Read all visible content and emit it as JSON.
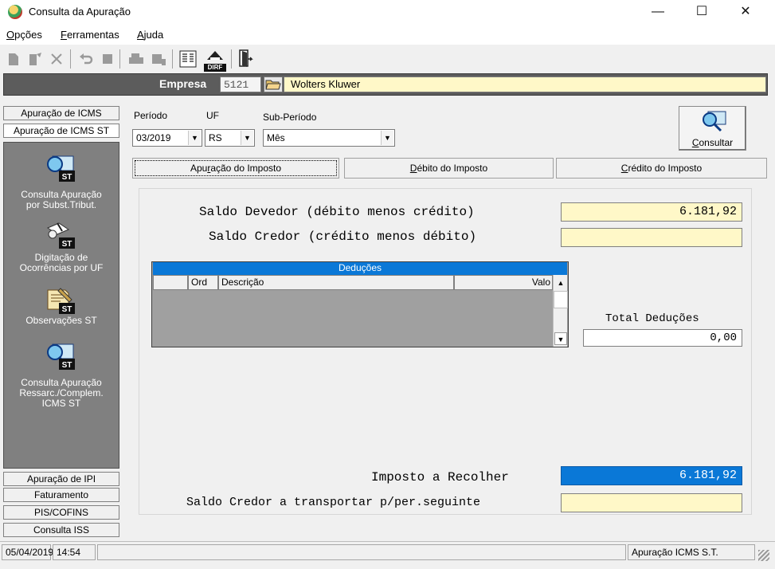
{
  "window": {
    "title": "Consulta da Apuração",
    "minimize": "—",
    "maximize": "☐",
    "close": "✕"
  },
  "menu": [
    {
      "label": "Opções",
      "accel": "O",
      "rest": "pções"
    },
    {
      "label": "Ferramentas",
      "accel": "F",
      "rest": "erramentas"
    },
    {
      "label": "Ajuda",
      "accel": "A",
      "rest": "juda"
    }
  ],
  "toolbar": {
    "icons": [
      "new-doc-icon",
      "edit-doc-icon",
      "delete-icon",
      "undo-icon",
      "stop-icon",
      "print-icon",
      "preview-icon",
      "report-icon",
      "dirf-icon",
      "exit-door-icon"
    ],
    "dirf_label": "DIRF"
  },
  "empresa": {
    "label": "Empresa",
    "code": "5121",
    "name": "Wolters Kluwer"
  },
  "sidebar": {
    "top_tabs": [
      "Apuração de ICMS",
      "Apuração de ICMS ST"
    ],
    "items": [
      {
        "caption": "Consulta Apuração por Subst.Tribut.",
        "lines": [
          "Consulta Apuração",
          "por Subst.Tribut."
        ],
        "icon": "consult-st-icon"
      },
      {
        "caption": "Digitação de Ocorrências por UF",
        "lines": [
          "Digitação de",
          "Ocorrências por UF"
        ],
        "icon": "typing-st-icon"
      },
      {
        "caption": "Observações ST",
        "lines": [
          "Observações ST"
        ],
        "icon": "notes-st-icon"
      },
      {
        "caption": "Consulta Apuração Ressarc./Complem. ICMS ST",
        "lines": [
          "Consulta Apuração",
          "Ressarc./Complem.",
          "ICMS ST"
        ],
        "icon": "consult-ressarc-st-icon"
      }
    ],
    "st_badge": "ST",
    "bottom_tabs": [
      "Apuração de IPI",
      "Faturamento",
      "PIS/COFINS",
      "Consulta ISS"
    ]
  },
  "filters": {
    "periodo_label": "Período",
    "periodo_value": "03/2019",
    "uf_label": "UF",
    "uf_value": "RS",
    "subperiodo_label": "Sub-Período",
    "subperiodo_value": "Mês",
    "consultar_label": "Consultar",
    "consultar_accel": "C",
    "consultar_rest": "onsultar"
  },
  "tabs": [
    {
      "label": "Apuração do Imposto",
      "pre": "Apu",
      "accel": "r",
      "post": "ação do Imposto",
      "active": true
    },
    {
      "label": "Débito do Imposto",
      "pre": "",
      "accel": "D",
      "post": "ébito do Imposto",
      "active": false
    },
    {
      "label": "Crédito do Imposto",
      "pre": "",
      "accel": "C",
      "post": "rédito do Imposto",
      "active": false
    }
  ],
  "apuracao": {
    "saldo_devedor_label": "Saldo Devedor (débito menos crédito)",
    "saldo_devedor_value": "6.181,92",
    "saldo_credor_label": "Saldo Credor (crédito menos débito)",
    "saldo_credor_value": "",
    "deducoes": {
      "title": "Deduções",
      "columns": [
        "",
        "Ord",
        "Descrição",
        "Valo"
      ],
      "rows": []
    },
    "total_deducoes_label": "Total Deduções",
    "total_deducoes_value": "0,00",
    "imposto_recolher_label": "Imposto a Recolher",
    "imposto_recolher_value": "6.181,92",
    "saldo_transportar_label": "Saldo Credor a transportar p/per.seguinte",
    "saldo_transportar_value": ""
  },
  "status": {
    "date": "05/04/2019",
    "time": "14:54",
    "module": "Apuração ICMS S.T."
  },
  "colors": {
    "accent_blue": "#0a78d7",
    "field_yellow": "#fff8c8",
    "sidebar_gray": "#808080"
  }
}
